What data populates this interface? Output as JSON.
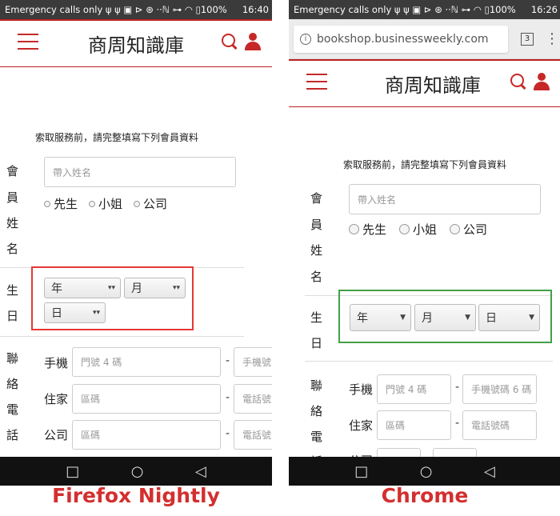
{
  "firefox": {
    "status": {
      "left": "Emergency calls only ψ ψ ▣ ⊳ ⊛ ··ℕ ⊶ ◠ ▯100%",
      "time": "16:40"
    },
    "site_title": "商周知識庫",
    "notice": "索取服務前，請完整填寫下列會員資料",
    "name_label": [
      "會",
      "員",
      "姓",
      "名"
    ],
    "name_placeholder": "帶入姓名",
    "radios": [
      "先生",
      "小姐",
      "公司"
    ],
    "birthday_label": [
      "生",
      "日"
    ],
    "selects": [
      "年",
      "月",
      "日"
    ],
    "contact_label": [
      "聯",
      "絡",
      "電",
      "話"
    ],
    "phones": [
      {
        "label": "手機",
        "field1": "門號 4 碼",
        "field2": "手機號"
      },
      {
        "label": "住家",
        "field1": "區碼",
        "field2": "電話號"
      },
      {
        "label": "公司",
        "field1": "區碼",
        "field2": "電話號"
      }
    ],
    "caption": "Firefox Nightly",
    "caption_color": "#d32f2f",
    "highlight_color": "#e53935"
  },
  "chrome": {
    "status": {
      "left": "Emergency calls only ψ ψ ▣ ⊳ ⊛ ··ℕ ⊶ ◠ ▯100%",
      "time": "16:26"
    },
    "url": "bookshop.businessweekly.com",
    "tab_count": "3",
    "site_title": "商周知識庫",
    "notice": "索取服務前，請完整填寫下列會員資料",
    "name_label": [
      "會",
      "員",
      "姓",
      "名"
    ],
    "name_placeholder": "帶入姓名",
    "radios": [
      "先生",
      "小姐",
      "公司"
    ],
    "birthday_label": [
      "生",
      "日"
    ],
    "selects": [
      "年",
      "月",
      "日"
    ],
    "contact_label": [
      "聯",
      "絡",
      "電",
      "話"
    ],
    "phones": [
      {
        "label": "手機",
        "field1": "門號 4 碼",
        "field2": "手機號碼 6 碼"
      },
      {
        "label": "住家",
        "field1": "區碼",
        "field2": "電話號碼"
      },
      {
        "label": "公司",
        "field1": "",
        "field2": ""
      }
    ],
    "caption": "Chrome",
    "caption_color": "#d32f2f",
    "highlight_color": "#43a047"
  },
  "navbar": {
    "back": "◁",
    "home": "○",
    "recents": "□"
  }
}
